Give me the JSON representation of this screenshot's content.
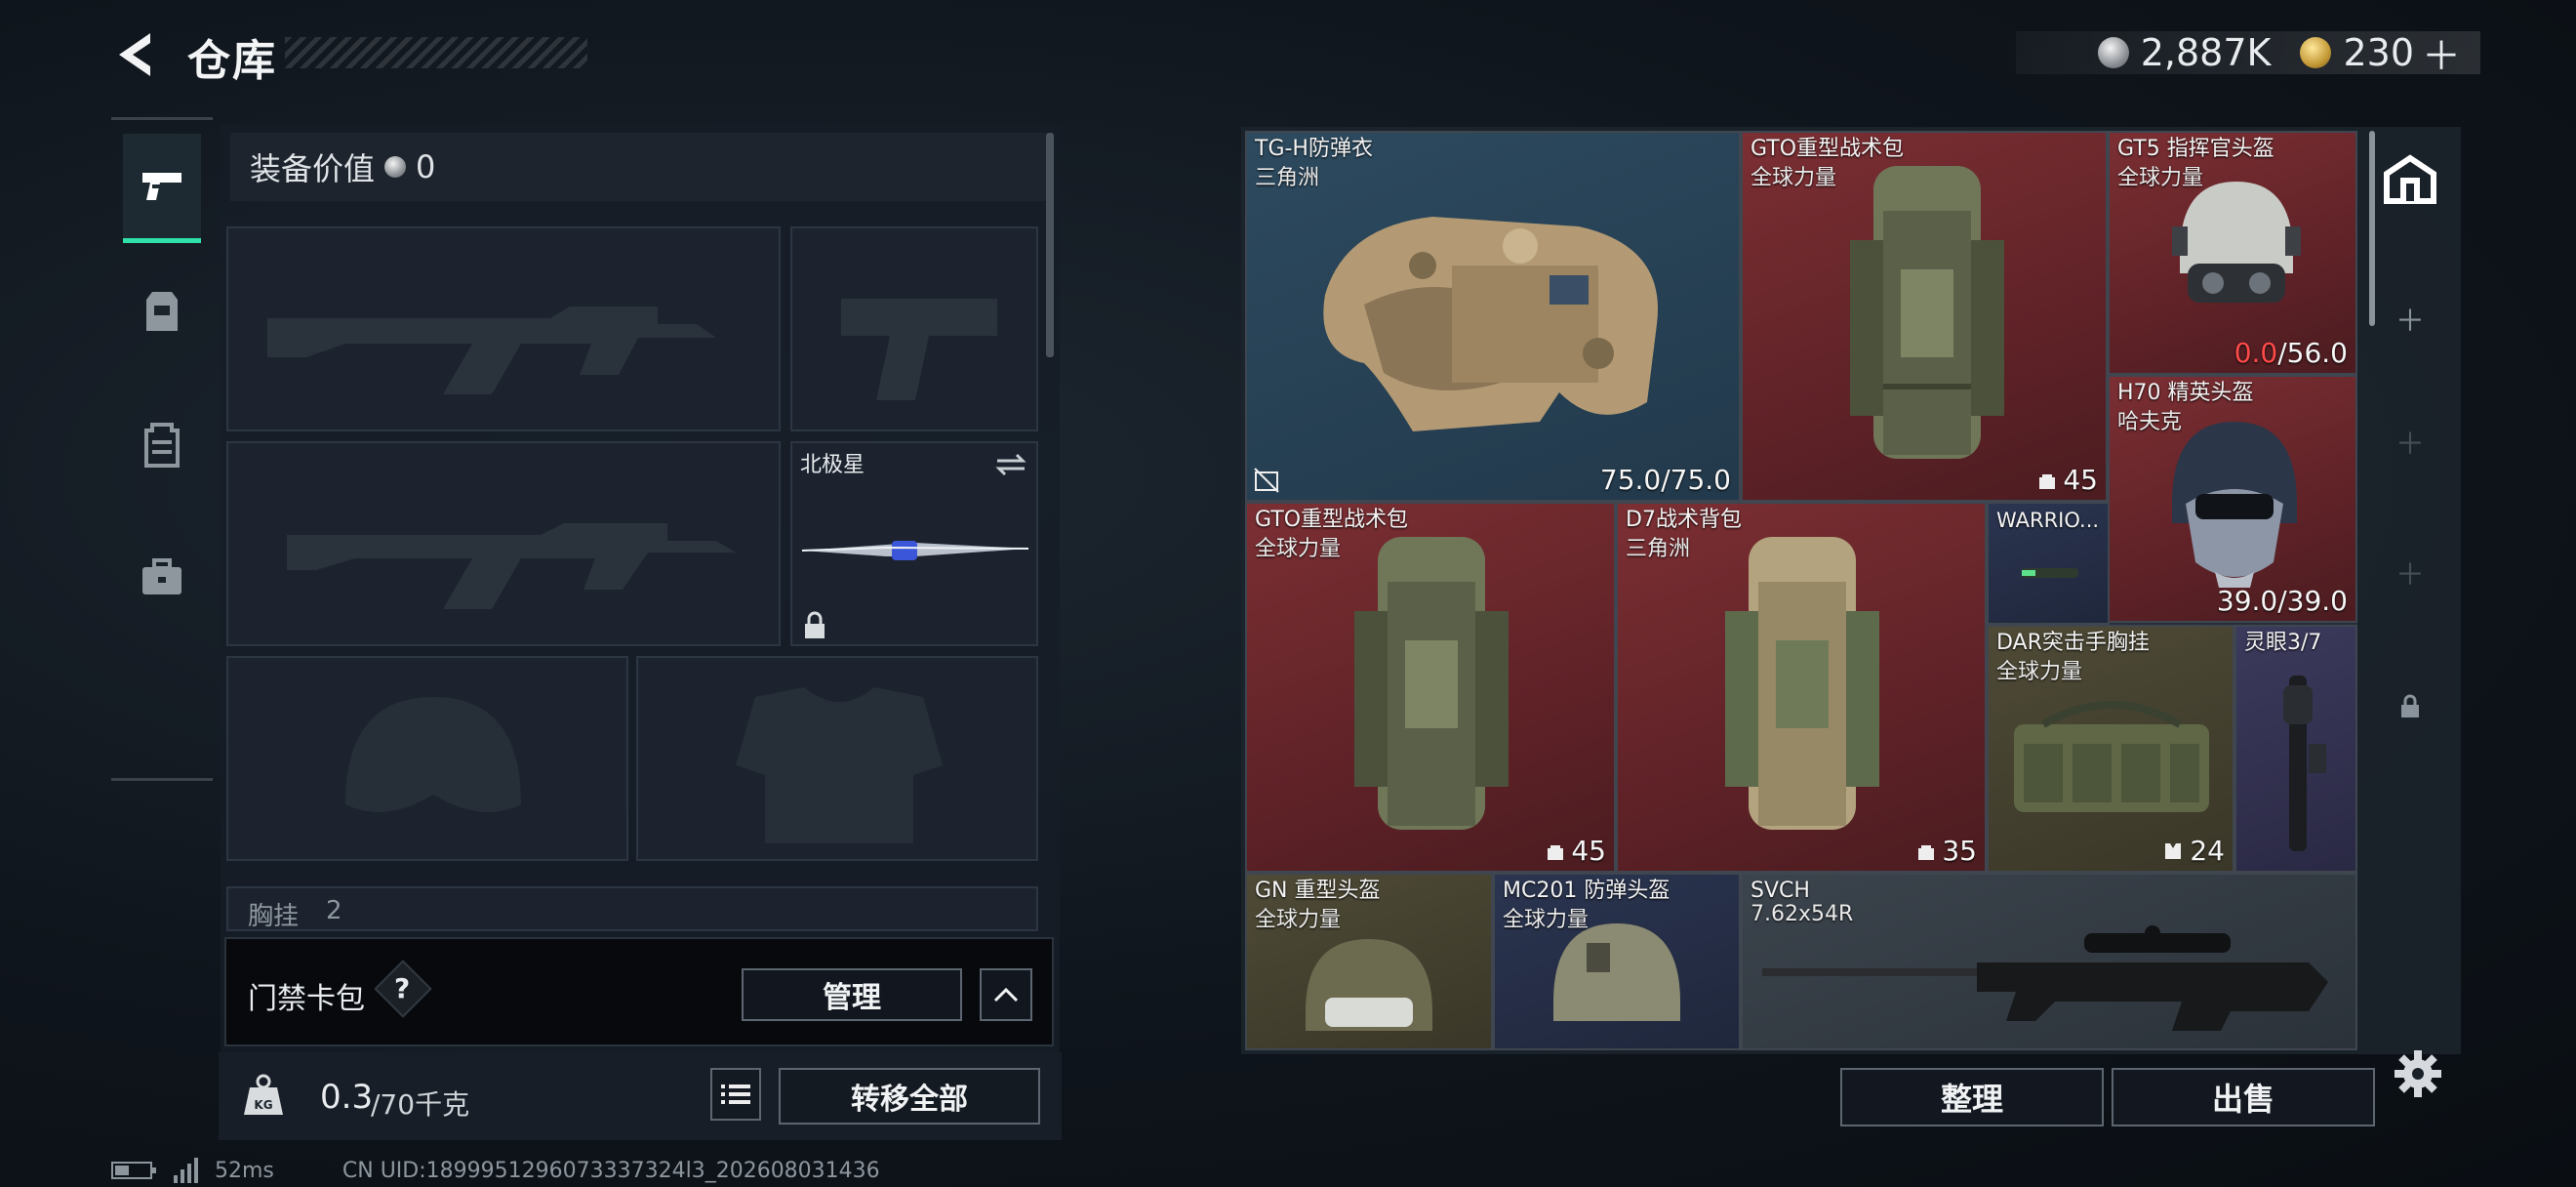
{
  "header": {
    "title": "仓库",
    "currency_silver": "2,887K",
    "currency_gold": "230"
  },
  "loadout": {
    "equipment_value_label": "装备价值",
    "equipment_value": "0",
    "melee_name": "北极星",
    "chest_rig_label": "胸挂",
    "chest_rig_value": "2"
  },
  "card_pack": {
    "label": "门禁卡包",
    "manage_label": "管理"
  },
  "capacity": {
    "current": "0.3",
    "max": "/70千克",
    "transfer_all_label": "转移全部"
  },
  "stash": {
    "items": [
      {
        "name": "TG-H防弹衣",
        "sub": "三角洲",
        "value": "75.0/75.0",
        "icon": "no-insure-icon"
      },
      {
        "name": "GTO重型战术包",
        "sub": "全球力量",
        "value": "45",
        "icon": "capacity-icon"
      },
      {
        "name": "GT5 指挥官头盔",
        "sub": "全球力量",
        "value_low": "0.0",
        "value": "/56.0"
      },
      {
        "name": "H70 精英头盔",
        "sub": "哈夫克",
        "value": "39.0/39.0"
      },
      {
        "name": "GTO重型战术包",
        "sub": "全球力量",
        "value": "45",
        "icon": "capacity-icon"
      },
      {
        "name": "D7战术背包",
        "sub": "三角洲",
        "value": "35",
        "icon": "capacity-icon"
      },
      {
        "name": "WARRIO...",
        "sub": "",
        "value": ""
      },
      {
        "name": "DAR突击手胸挂",
        "sub": "全球力量",
        "value": "24",
        "icon": "rig-slots-icon"
      },
      {
        "name": "灵眼3/7",
        "sub": "",
        "value": ""
      },
      {
        "name": "GN 重型头盔",
        "sub": "全球力量",
        "value": ""
      },
      {
        "name": "MC201 防弹头盔",
        "sub": "全球力量",
        "value": ""
      },
      {
        "name": "SVCH",
        "sub": "7.62x54R",
        "value": ""
      }
    ],
    "sort_label": "整理",
    "sell_label": "出售"
  },
  "status_bar": {
    "ping": "52ms",
    "uid": "CN UID:1899951296073337324l3_202608031436"
  },
  "colors": {
    "accent": "#2fe0a8",
    "rarity_red": "#6a262b",
    "rarity_blue": "#263f52",
    "low_value": "#ff4a4a"
  }
}
